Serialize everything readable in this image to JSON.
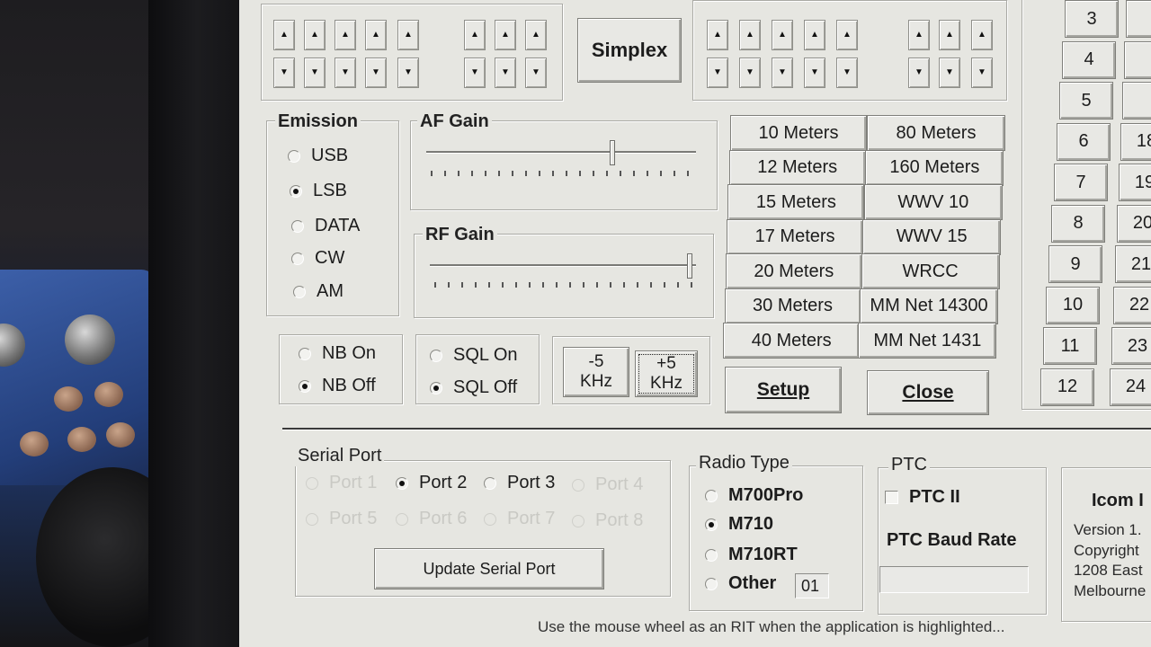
{
  "top": {
    "simplex_label": "Simplex"
  },
  "emission": {
    "title": "Emission",
    "options": [
      {
        "label": "USB",
        "selected": false
      },
      {
        "label": "LSB",
        "selected": true
      },
      {
        "label": "DATA",
        "selected": false
      },
      {
        "label": "CW",
        "selected": false
      },
      {
        "label": "AM",
        "selected": false
      }
    ]
  },
  "af_gain": {
    "title": "AF Gain",
    "level": 0.68
  },
  "rf_gain": {
    "title": "RF Gain",
    "level": 0.98
  },
  "noise_blanker": {
    "options": [
      {
        "label": "NB On",
        "selected": false
      },
      {
        "label": "NB Off",
        "selected": true
      }
    ]
  },
  "squelch": {
    "options": [
      {
        "label": "SQL On",
        "selected": false
      },
      {
        "label": "SQL Off",
        "selected": true
      }
    ]
  },
  "offset": {
    "minus_label": "-5\nKHz",
    "plus_label": "+5\nKHz"
  },
  "bands": {
    "left": [
      "10 Meters",
      "12 Meters",
      "15 Meters",
      "17 Meters",
      "20 Meters",
      "30 Meters",
      "40 Meters"
    ],
    "right": [
      "80 Meters",
      "160 Meters",
      "WWV 10",
      "WWV 15",
      "WRCC",
      "MM Net 14300",
      "MM Net 1431"
    ]
  },
  "actions": {
    "setup_label": "Setup",
    "close_label": "Close"
  },
  "channels": {
    "col1": [
      "3",
      "4",
      "5",
      "6",
      "7",
      "8",
      "9",
      "10",
      "11",
      "12"
    ],
    "col2": [
      "",
      "",
      "",
      "18",
      "19",
      "20",
      "21",
      "22",
      "23",
      "24"
    ]
  },
  "serial_port": {
    "title": "Serial Port",
    "ports": [
      {
        "label": "Port 1",
        "selected": false,
        "enabled": false
      },
      {
        "label": "Port 2",
        "selected": true,
        "enabled": true
      },
      {
        "label": "Port 3",
        "selected": false,
        "enabled": true
      },
      {
        "label": "Port 4",
        "selected": false,
        "enabled": false
      },
      {
        "label": "Port 5",
        "selected": false,
        "enabled": false
      },
      {
        "label": "Port 6",
        "selected": false,
        "enabled": false
      },
      {
        "label": "Port 7",
        "selected": false,
        "enabled": false
      },
      {
        "label": "Port 8",
        "selected": false,
        "enabled": false
      }
    ],
    "update_label": "Update Serial Port"
  },
  "radio_type": {
    "title": "Radio Type",
    "options": [
      {
        "label": "M700Pro",
        "selected": false
      },
      {
        "label": "M710",
        "selected": true
      },
      {
        "label": "M710RT",
        "selected": false
      },
      {
        "label": "Other",
        "selected": false
      }
    ],
    "other_value": "01"
  },
  "ptc": {
    "title": "PTC",
    "ptc2_label": "PTC II",
    "ptc2_checked": false,
    "baud_title": "PTC Baud Rate",
    "baud_value": ""
  },
  "about": {
    "title": "Icom I",
    "lines": [
      "Version 1.",
      "Copyright",
      "1208 East",
      "Melbourne"
    ]
  },
  "status_text": "Use the mouse wheel as an RIT when the application is highlighted..."
}
